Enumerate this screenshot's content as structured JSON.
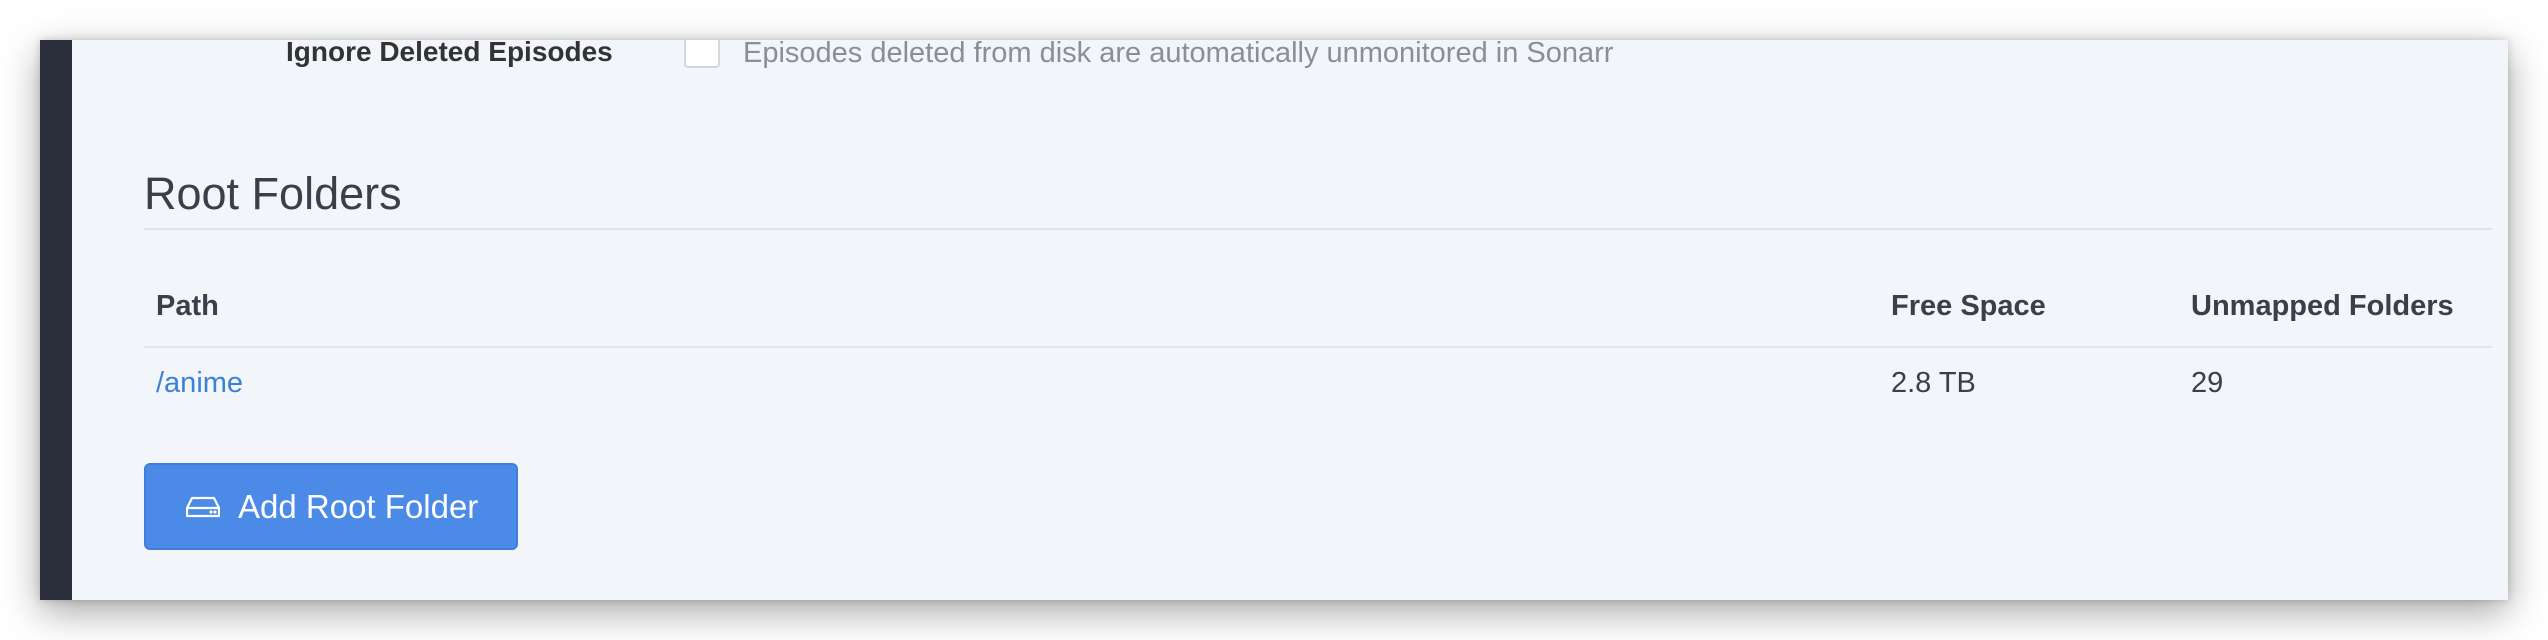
{
  "setting": {
    "label": "Ignore Deleted Episodes",
    "help": "Episodes deleted from disk are automatically unmonitored in Sonarr",
    "checked": false
  },
  "root_folders": {
    "title": "Root Folders",
    "columns": {
      "path": "Path",
      "free_space": "Free Space",
      "unmapped": "Unmapped Folders"
    },
    "rows": [
      {
        "path": "/anime",
        "free_space": "2.8 TB",
        "unmapped": "29",
        "delete_icon": "×"
      }
    ],
    "add_button": {
      "label": "Add Root Folder",
      "icon": "drive-icon"
    }
  },
  "colors": {
    "accent": "#4b8ae6",
    "link": "#3b82d6",
    "sidebar": "#2a2d3a",
    "background": "#f2f5f9"
  }
}
